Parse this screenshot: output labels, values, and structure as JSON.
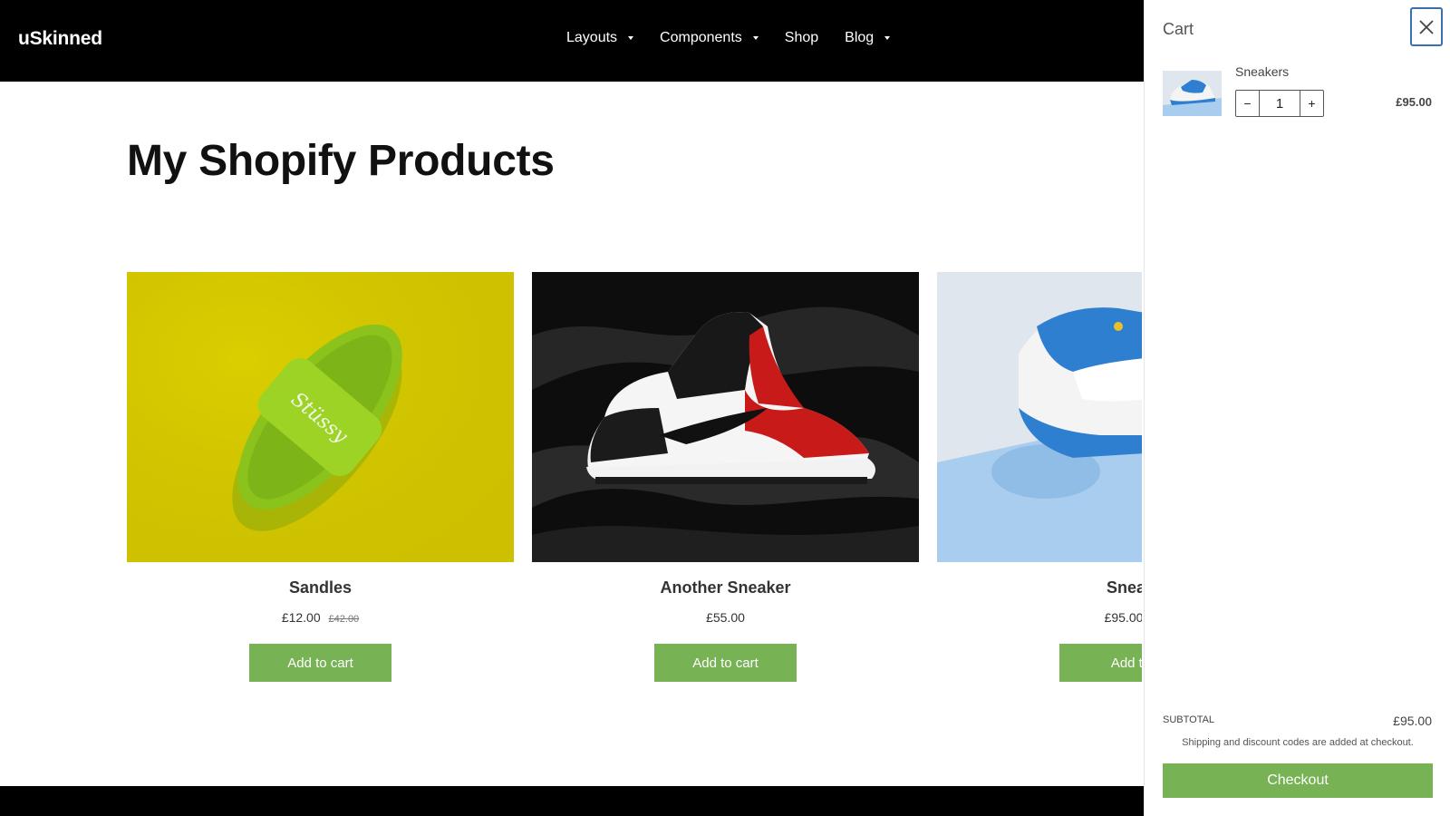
{
  "header": {
    "logo": "uSkinned",
    "nav": [
      {
        "label": "Layouts",
        "has_dropdown": true
      },
      {
        "label": "Components",
        "has_dropdown": true
      },
      {
        "label": "Shop",
        "has_dropdown": false
      },
      {
        "label": "Blog",
        "has_dropdown": true
      }
    ]
  },
  "main": {
    "title": "My Shopify Products",
    "products": [
      {
        "name": "Sandles",
        "price": "£12.00",
        "old_price": "£42.00",
        "button": "Add to cart",
        "image": "green-slide-sandal-photo"
      },
      {
        "name": "Another Sneaker",
        "price": "£55.00",
        "old_price": "",
        "button": "Add to cart",
        "image": "red-black-high-top-sneaker-photo"
      },
      {
        "name": "Sneak",
        "price": "£95.00",
        "old_price": "£",
        "button": "Add to",
        "image": "blue-white-sneaker-photo"
      }
    ]
  },
  "cart": {
    "title": "Cart",
    "close_icon": "close-icon",
    "items": [
      {
        "name": "Sneakers",
        "quantity": "1",
        "price": "£95.00",
        "minus": "−",
        "plus": "+"
      }
    ],
    "subtotal_label": "SUBTOTAL",
    "subtotal_value": "£95.00",
    "shipping_note": "Shipping and discount codes are added at checkout.",
    "checkout_label": "Checkout"
  },
  "colors": {
    "header_bg": "#000000",
    "button_green": "#77b255",
    "close_focus": "#3a6fb4"
  }
}
